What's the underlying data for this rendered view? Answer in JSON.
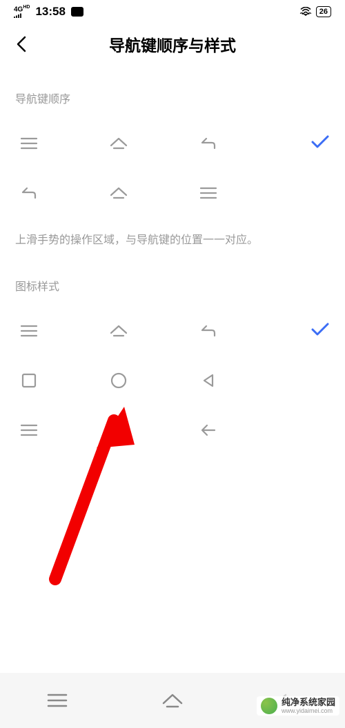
{
  "status_bar": {
    "network": "4G",
    "network_sub": "HD",
    "time": "13:58",
    "battery": "26"
  },
  "header": {
    "title": "导航键顺序与样式"
  },
  "sections": {
    "order": {
      "label": "导航键顺序",
      "hint": "上滑手势的操作区域，与导航键的位置一一对应。"
    },
    "style": {
      "label": "图标样式"
    }
  },
  "watermark": {
    "name": "纯净系统家园",
    "url": "www.yidaimei.com"
  }
}
